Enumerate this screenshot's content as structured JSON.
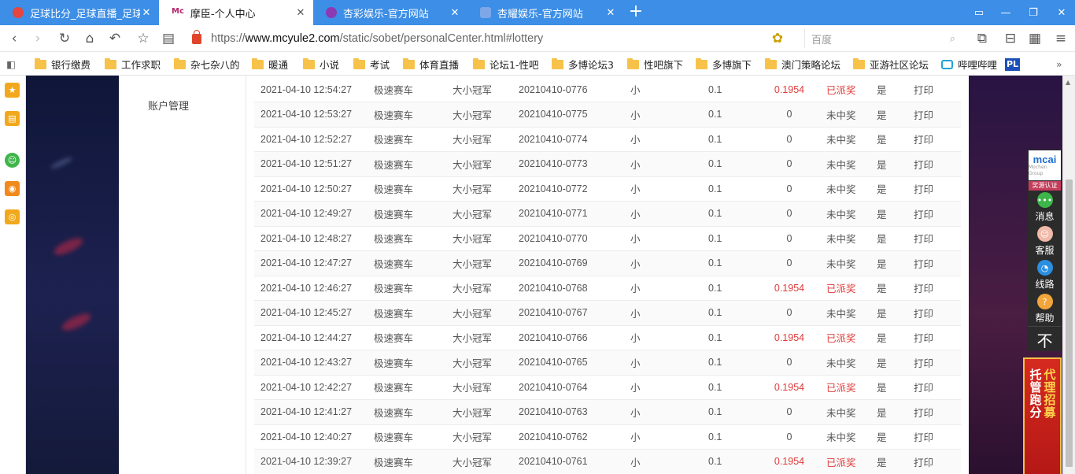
{
  "tabs": [
    {
      "title": "足球比分_足球直播_足球比",
      "icon": "soccer-favicon",
      "active": false
    },
    {
      "title": "摩臣-个人中心",
      "icon": "mochen-favicon",
      "active": true
    },
    {
      "title": "杏彩娱乐-官方网站",
      "icon": "xingcai-favicon",
      "active": false
    },
    {
      "title": "杏耀娱乐-官方网站",
      "icon": "xingyao-favicon",
      "active": false
    }
  ],
  "address": {
    "scheme": "https://",
    "domain": "www.mcyule2.com",
    "path": "/static/sobet/personalCenter.html#lottery"
  },
  "search": {
    "placeholder": "百度"
  },
  "bookmarks": [
    "银行缴费",
    "工作求职",
    "杂七杂八的",
    "暖通",
    "小说",
    "考试",
    "体育直播",
    "论坛1-性吧",
    "多博论坛3",
    "性吧旗下",
    "多博旗下",
    "澳门策略论坛",
    "亚游社区论坛",
    "哔哩哔哩"
  ],
  "bookmark_pl": "PL",
  "leftnav": {
    "account_management": "账户管理"
  },
  "records": [
    {
      "time": "2021-04-10 12:54:27",
      "lottery": "极速赛车",
      "play": "大小冠军",
      "issue": "20210410-0776",
      "bet": "小",
      "amount": "0.1",
      "prize": "0.1954",
      "status": "已派奖",
      "win": true,
      "flag": "是",
      "action": "打印"
    },
    {
      "time": "2021-04-10 12:53:27",
      "lottery": "极速赛车",
      "play": "大小冠军",
      "issue": "20210410-0775",
      "bet": "小",
      "amount": "0.1",
      "prize": "0",
      "status": "未中奖",
      "win": false,
      "flag": "是",
      "action": "打印"
    },
    {
      "time": "2021-04-10 12:52:27",
      "lottery": "极速赛车",
      "play": "大小冠军",
      "issue": "20210410-0774",
      "bet": "小",
      "amount": "0.1",
      "prize": "0",
      "status": "未中奖",
      "win": false,
      "flag": "是",
      "action": "打印"
    },
    {
      "time": "2021-04-10 12:51:27",
      "lottery": "极速赛车",
      "play": "大小冠军",
      "issue": "20210410-0773",
      "bet": "小",
      "amount": "0.1",
      "prize": "0",
      "status": "未中奖",
      "win": false,
      "flag": "是",
      "action": "打印"
    },
    {
      "time": "2021-04-10 12:50:27",
      "lottery": "极速赛车",
      "play": "大小冠军",
      "issue": "20210410-0772",
      "bet": "小",
      "amount": "0.1",
      "prize": "0",
      "status": "未中奖",
      "win": false,
      "flag": "是",
      "action": "打印"
    },
    {
      "time": "2021-04-10 12:49:27",
      "lottery": "极速赛车",
      "play": "大小冠军",
      "issue": "20210410-0771",
      "bet": "小",
      "amount": "0.1",
      "prize": "0",
      "status": "未中奖",
      "win": false,
      "flag": "是",
      "action": "打印"
    },
    {
      "time": "2021-04-10 12:48:27",
      "lottery": "极速赛车",
      "play": "大小冠军",
      "issue": "20210410-0770",
      "bet": "小",
      "amount": "0.1",
      "prize": "0",
      "status": "未中奖",
      "win": false,
      "flag": "是",
      "action": "打印"
    },
    {
      "time": "2021-04-10 12:47:27",
      "lottery": "极速赛车",
      "play": "大小冠军",
      "issue": "20210410-0769",
      "bet": "小",
      "amount": "0.1",
      "prize": "0",
      "status": "未中奖",
      "win": false,
      "flag": "是",
      "action": "打印"
    },
    {
      "time": "2021-04-10 12:46:27",
      "lottery": "极速赛车",
      "play": "大小冠军",
      "issue": "20210410-0768",
      "bet": "小",
      "amount": "0.1",
      "prize": "0.1954",
      "status": "已派奖",
      "win": true,
      "flag": "是",
      "action": "打印"
    },
    {
      "time": "2021-04-10 12:45:27",
      "lottery": "极速赛车",
      "play": "大小冠军",
      "issue": "20210410-0767",
      "bet": "小",
      "amount": "0.1",
      "prize": "0",
      "status": "未中奖",
      "win": false,
      "flag": "是",
      "action": "打印"
    },
    {
      "time": "2021-04-10 12:44:27",
      "lottery": "极速赛车",
      "play": "大小冠军",
      "issue": "20210410-0766",
      "bet": "小",
      "amount": "0.1",
      "prize": "0.1954",
      "status": "已派奖",
      "win": true,
      "flag": "是",
      "action": "打印"
    },
    {
      "time": "2021-04-10 12:43:27",
      "lottery": "极速赛车",
      "play": "大小冠军",
      "issue": "20210410-0765",
      "bet": "小",
      "amount": "0.1",
      "prize": "0",
      "status": "未中奖",
      "win": false,
      "flag": "是",
      "action": "打印"
    },
    {
      "time": "2021-04-10 12:42:27",
      "lottery": "极速赛车",
      "play": "大小冠军",
      "issue": "20210410-0764",
      "bet": "小",
      "amount": "0.1",
      "prize": "0.1954",
      "status": "已派奖",
      "win": true,
      "flag": "是",
      "action": "打印"
    },
    {
      "time": "2021-04-10 12:41:27",
      "lottery": "极速赛车",
      "play": "大小冠军",
      "issue": "20210410-0763",
      "bet": "小",
      "amount": "0.1",
      "prize": "0",
      "status": "未中奖",
      "win": false,
      "flag": "是",
      "action": "打印"
    },
    {
      "time": "2021-04-10 12:40:27",
      "lottery": "极速赛车",
      "play": "大小冠军",
      "issue": "20210410-0762",
      "bet": "小",
      "amount": "0.1",
      "prize": "0",
      "status": "未中奖",
      "win": false,
      "flag": "是",
      "action": "打印"
    },
    {
      "time": "2021-04-10 12:39:27",
      "lottery": "极速赛车",
      "play": "大小冠军",
      "issue": "20210410-0761",
      "bet": "小",
      "amount": "0.1",
      "prize": "0.1954",
      "status": "已派奖",
      "win": true,
      "flag": "是",
      "action": "打印"
    }
  ],
  "float_panel": {
    "logo_text": "mcai",
    "logo_sub": "Mochen Group",
    "cert": "奖源认证",
    "items": [
      {
        "label": "消息",
        "icon": "message-icon",
        "color": "#3db54a"
      },
      {
        "label": "客服",
        "icon": "customer-service-icon",
        "color": "#f0b9a8"
      },
      {
        "label": "线路",
        "icon": "route-icon",
        "color": "#2b8fe0"
      },
      {
        "label": "帮助",
        "icon": "help-icon",
        "color": "#f2a53a"
      }
    ],
    "top_label": "不"
  },
  "banner": {
    "line1": "托管跑分",
    "line2": "代理招募"
  },
  "colors": {
    "tabbar": "#3c8ee6",
    "win": "#e03b3b",
    "folder": "#f7c24a"
  }
}
